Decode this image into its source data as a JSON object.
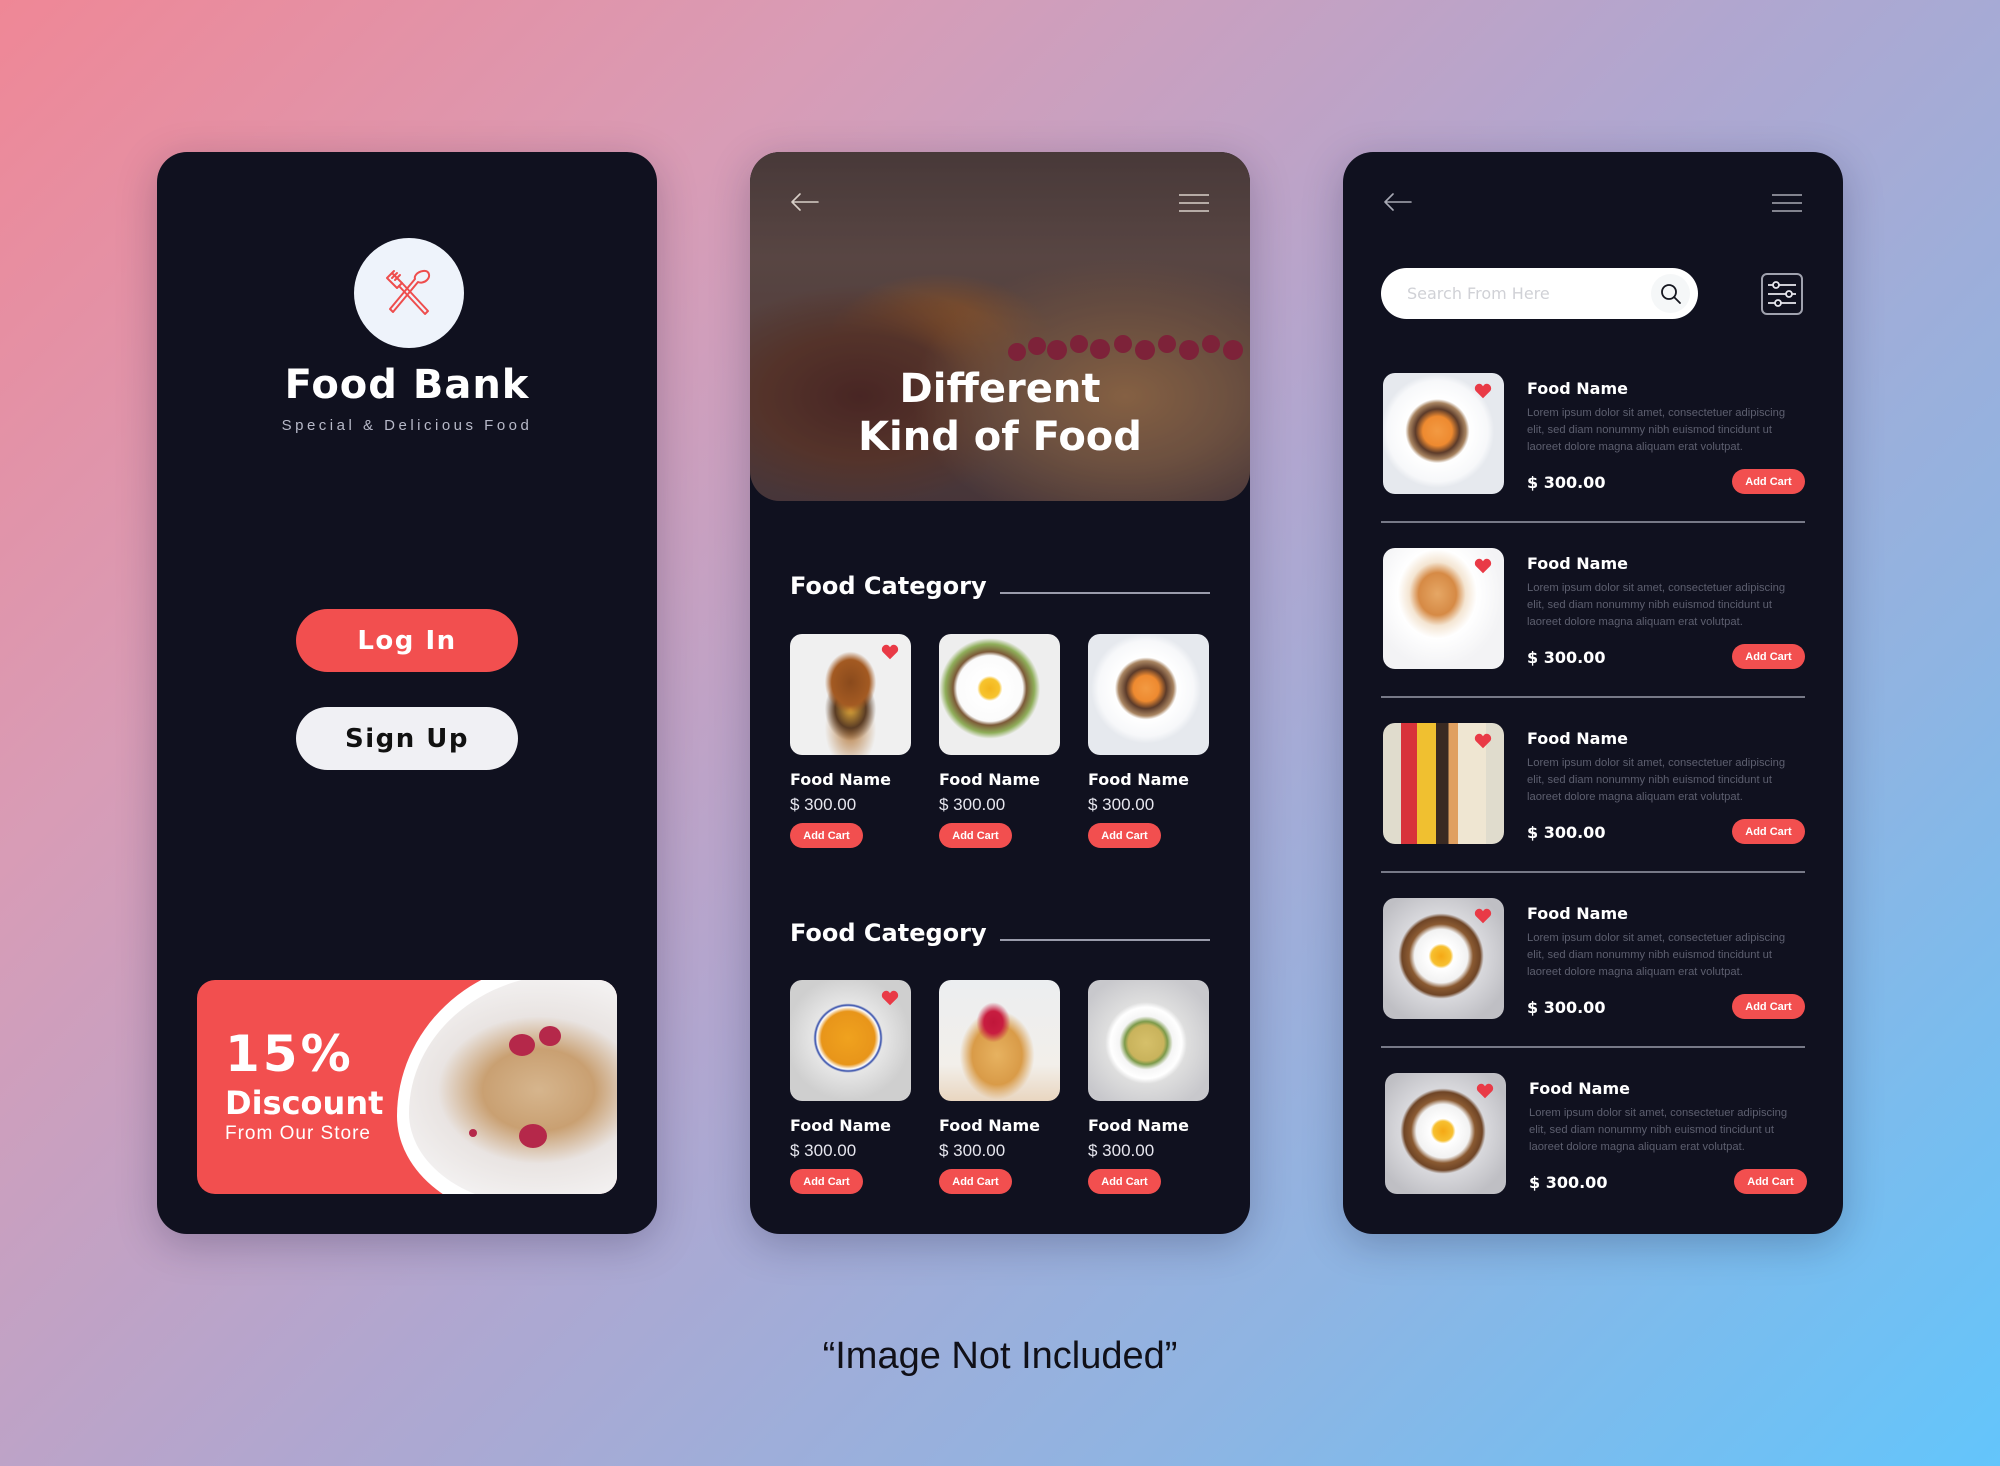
{
  "colors": {
    "accent": "#f24f4f",
    "card_bg": "#10111f",
    "heart": "#e93a46",
    "background_start": "#ef8796",
    "background_end": "#63c5fb"
  },
  "screen_login": {
    "logo_icon": "fork-spoon-crossed-icon",
    "brand_title": "Food Bank",
    "brand_subtitle": "Special & Delicious Food",
    "login_label": "Log In",
    "signup_label": "Sign Up",
    "promo": {
      "percent": "15%",
      "title": "Discount",
      "subtitle": "From Our Store",
      "image": "pancake-stack-photo"
    }
  },
  "screen_category": {
    "back_icon": "arrow-left-icon",
    "menu_icon": "hamburger-menu-icon",
    "hero_title_line1": "Different",
    "hero_title_line2": "Kind of Food",
    "sections": [
      {
        "title": "Food Category",
        "items": [
          {
            "name": "Food Name",
            "price": "$ 300.00",
            "cta": "Add Cart",
            "image": "burger-photo",
            "favorite": true
          },
          {
            "name": "Food Name",
            "price": "$ 300.00",
            "cta": "Add Cart",
            "image": "egg-toast-photo",
            "favorite": false
          },
          {
            "name": "Food Name",
            "price": "$ 300.00",
            "cta": "Add Cart",
            "image": "peach-granola-bowl-photo",
            "favorite": false
          }
        ]
      },
      {
        "title": "Food Category",
        "items": [
          {
            "name": "Food Name",
            "price": "$ 300.00",
            "cta": "Add Cart",
            "image": "pumpkin-soup-photo",
            "favorite": true
          },
          {
            "name": "Food Name",
            "price": "$ 300.00",
            "cta": "Add Cart",
            "image": "berry-pancakes-photo",
            "favorite": false
          },
          {
            "name": "Food Name",
            "price": "$ 300.00",
            "cta": "Add Cart",
            "image": "pasta-plate-photo",
            "favorite": false
          }
        ]
      }
    ]
  },
  "screen_list": {
    "back_icon": "arrow-left-icon",
    "menu_icon": "hamburger-menu-icon",
    "search_placeholder": "Search From Here",
    "search_value": "",
    "items": [
      {
        "name": "Food Name",
        "description": "Lorem ipsum dolor sit amet, consectetuer adipiscing elit, sed diam nonummy nibh euismod tincidunt ut laoreet dolore magna aliquam erat volutpat.",
        "price": "$ 300.00",
        "cta": "Add Cart",
        "image": "peach-granola-bowl-photo",
        "favorite": true
      },
      {
        "name": "Food Name",
        "description": "Lorem ipsum dolor sit amet, consectetuer adipiscing elit, sed diam nonummy nibh euismod tincidunt ut laoreet dolore magna aliquam erat volutpat.",
        "price": "$ 300.00",
        "cta": "Add Cart",
        "image": "bagel-plate-photo",
        "favorite": true
      },
      {
        "name": "Food Name",
        "description": "Lorem ipsum dolor sit amet, consectetuer adipiscing elit, sed diam nonummy nibh euismod tincidunt ut laoreet dolore magna aliquam erat volutpat.",
        "price": "$ 300.00",
        "cta": "Add Cart",
        "image": "smoothie-bowl-photo",
        "favorite": true
      },
      {
        "name": "Food Name",
        "description": "Lorem ipsum dolor sit amet, consectetuer adipiscing elit, sed diam nonummy nibh euismod tincidunt ut laoreet dolore magna aliquam erat volutpat.",
        "price": "$ 300.00",
        "cta": "Add Cart",
        "image": "egg-toast-photo",
        "favorite": true
      },
      {
        "name": "Food Name",
        "description": "Lorem ipsum dolor sit amet, consectetuer adipiscing elit, sed diam nonummy nibh euismod tincidunt ut laoreet dolore magna aliquam erat volutpat.",
        "price": "$ 300.00",
        "cta": "Add Cart",
        "image": "egg-toast-photo",
        "favorite": true
      }
    ]
  },
  "caption": "“Image Not Included”"
}
